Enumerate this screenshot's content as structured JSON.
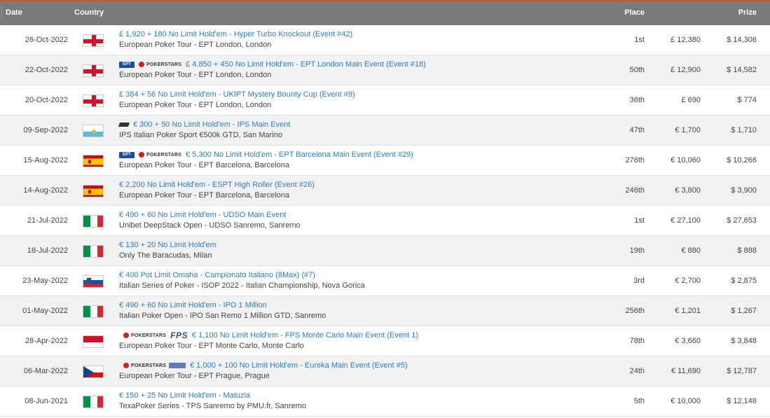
{
  "columns": {
    "date": "Date",
    "country": "Country",
    "place": "Place",
    "prize": "Prize"
  },
  "rows": [
    {
      "date": "26-Oct-2022",
      "flag": "england",
      "logos": [],
      "title": "£ 1,920 + 180 No Limit Hold'em - Hyper Turbo Knockout (Event #42)",
      "sub": "European Poker Tour - EPT London, London",
      "place": "1st",
      "buyin": "£ 12,380",
      "prize": "$ 14,306"
    },
    {
      "date": "22-Oct-2022",
      "flag": "england",
      "logos": [
        "ept",
        "pokerstars"
      ],
      "title": "£ 4,850 + 450 No Limit Hold'em - EPT London Main Event (Event #18)",
      "sub": "European Poker Tour - EPT London, London",
      "place": "50th",
      "buyin": "£ 12,900",
      "prize": "$ 14,582"
    },
    {
      "date": "20-Oct-2022",
      "flag": "england",
      "logos": [],
      "title": "£ 384 + 56 No Limit Hold'em - UKIPT Mystery Bounty Cup (Event #9)",
      "sub": "European Poker Tour - EPT London, London",
      "place": "36th",
      "buyin": "£ 690",
      "prize": "$ 774"
    },
    {
      "date": "09-Sep-2022",
      "flag": "sanmarino",
      "logos": [
        "ips"
      ],
      "title": "€ 300 + 50 No Limit Hold'em - IPS Main Event",
      "sub": "IPS Italian Poker Sport €500k GTD, San Marino",
      "place": "47th",
      "buyin": "€ 1,700",
      "prize": "$ 1,710"
    },
    {
      "date": "15-Aug-2022",
      "flag": "spain",
      "logos": [
        "ept",
        "pokerstars"
      ],
      "title": "€ 5,300 No Limit Hold'em - EPT Barcelona Main Event (Event #29)",
      "sub": "European Poker Tour - EPT Barcelona, Barcelona",
      "place": "276th",
      "buyin": "€ 10,060",
      "prize": "$ 10,266"
    },
    {
      "date": "14-Aug-2022",
      "flag": "spain",
      "logos": [],
      "title": "€ 2,200 No Limit Hold'em - ESPT High Roller (Event #26)",
      "sub": "European Poker Tour - EPT Barcelona, Barcelona",
      "place": "246th",
      "buyin": "€ 3,800",
      "prize": "$ 3,900"
    },
    {
      "date": "21-Jul-2022",
      "flag": "italy",
      "logos": [],
      "title": "€ 490 + 60 No Limit Hold'em - UDSO Main Event",
      "sub": "Unibet DeepStack Open - UDSO Sanremo, Sanremo",
      "place": "1st",
      "buyin": "€ 27,100",
      "prize": "$ 27,653"
    },
    {
      "date": "18-Jul-2022",
      "flag": "italy",
      "logos": [],
      "title": "€ 130 + 20 No Limit Hold'em",
      "sub": "Only The Baracudas, Milan",
      "place": "19th",
      "buyin": "€ 880",
      "prize": "$ 888"
    },
    {
      "date": "23-May-2022",
      "flag": "slovenia",
      "logos": [],
      "title": "€ 400 Pot Limit Omaha - Campionato Italiano (8Max) (#7)",
      "sub": "Italian Series of Poker - ISOP 2022 - Italian Championship, Nova Gorica",
      "place": "3rd",
      "buyin": "€ 2,700",
      "prize": "$ 2,875"
    },
    {
      "date": "01-May-2022",
      "flag": "italy",
      "logos": [],
      "title": "€ 490 + 60 No Limit Hold'em - IPO 1 Million",
      "sub": "Italian Poker Open - IPO San Remo 1 Million GTD, Sanremo",
      "place": "256th",
      "buyin": "€ 1,201",
      "prize": "$ 1,267"
    },
    {
      "date": "28-Apr-2022",
      "flag": "monaco",
      "logos": [
        "pokerstars",
        "fps"
      ],
      "title": "€ 1,100 No Limit Hold'em - FPS Monte Carlo Main Event (Event 1)",
      "sub": "European Poker Tour - EPT Monte Carlo, Monte Carlo",
      "place": "78th",
      "buyin": "€ 3,660",
      "prize": "$ 3,848"
    },
    {
      "date": "06-Mar-2022",
      "flag": "czech",
      "logos": [
        "pokerstars",
        "eureka"
      ],
      "title": "€ 1,000 + 100 No Limit Hold'em - Eureka Main Event (Event #5)",
      "sub": "European Poker Tour - EPT Prague, Prague",
      "place": "24th",
      "buyin": "€ 11,690",
      "prize": "$ 12,787"
    },
    {
      "date": "08-Jun-2021",
      "flag": "italy",
      "logos": [],
      "title": "€ 150 + 25 No Limit Hold'em - Matuzia",
      "sub": "TexaPoker Series - TPS Sanremo by PMU.fr, Sanremo",
      "place": "5th",
      "buyin": "€ 10,000",
      "prize": "$ 12,148"
    }
  ],
  "logo_text": {
    "ept": "EPT",
    "pokerstars": "POKERSTARS",
    "fps": "FPS"
  },
  "colors": {
    "link": "#2a7ccf",
    "header_bg": "#7a7a7a",
    "accent": "#c95a2a"
  }
}
